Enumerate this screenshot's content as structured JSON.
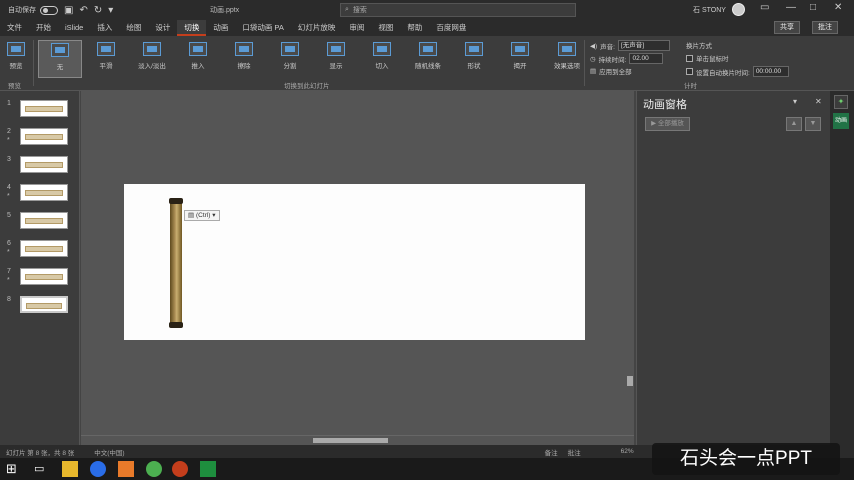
{
  "titlebar": {
    "autosave_label": "自动保存",
    "autosave_state": "关",
    "document_title": "动画.pptx",
    "search_placeholder": "搜索",
    "user_name": "石 STONY",
    "buttons": [
      "—",
      "□",
      "✕"
    ]
  },
  "tabs": [
    "文件",
    "开始",
    "iSlide",
    "插入",
    "绘图",
    "设计",
    "切换",
    "动画",
    "口袋动画 PA",
    "幻灯片放映",
    "审阅",
    "视图",
    "帮助",
    "百度网盘"
  ],
  "active_tab_index": 6,
  "share_label": "共享",
  "comment_label": "批注",
  "ribbon": {
    "preview_label": "预览",
    "preview_button": "预览",
    "transitions": [
      {
        "label": "无",
        "selected": true
      },
      {
        "label": "平滑"
      },
      {
        "label": "淡入/淡出"
      },
      {
        "label": "推入"
      },
      {
        "label": "擦除"
      },
      {
        "label": "分割"
      },
      {
        "label": "显示"
      },
      {
        "label": "切入"
      },
      {
        "label": "随机线条"
      },
      {
        "label": "形状"
      },
      {
        "label": "揭开"
      }
    ],
    "effect_options_label": "效果选项",
    "group_label": "切换到此幻灯片",
    "sound_label": "声音:",
    "sound_value": "[无声音]",
    "duration_label": "持续时间:",
    "duration_value": "02.00",
    "apply_all_label": "应用到全部",
    "advance_label": "换片方式",
    "on_click_label": "单击鼠标时",
    "after_label": "设置自动换片时间:",
    "after_value": "00:00.00",
    "timing_group_label": "计时"
  },
  "thumbnails": [
    {
      "num": "1",
      "star": ""
    },
    {
      "num": "2",
      "star": "*"
    },
    {
      "num": "3",
      "star": ""
    },
    {
      "num": "4",
      "star": "*"
    },
    {
      "num": "5",
      "star": ""
    },
    {
      "num": "6",
      "star": "*"
    },
    {
      "num": "7",
      "star": "*"
    },
    {
      "num": "8",
      "star": ""
    }
  ],
  "selected_slide": 8,
  "paste_options_label": "(Ctrl)",
  "animation_pane": {
    "title": "动画窗格",
    "play_button": "▶ 全部播放",
    "up": "▲",
    "down": "▼"
  },
  "side_tab": "动画",
  "status": {
    "slide_info": "幻灯片 第 8 张，共 8 张",
    "language": "中文(中国)",
    "notes": "备注",
    "comments": "批注",
    "zoom": "62%"
  },
  "watermark": "石头会一点PPT",
  "colors": {
    "accent": "#c43e1c",
    "ribbon_bg": "#3c3c3c",
    "title_bg": "#2b2b2b"
  }
}
